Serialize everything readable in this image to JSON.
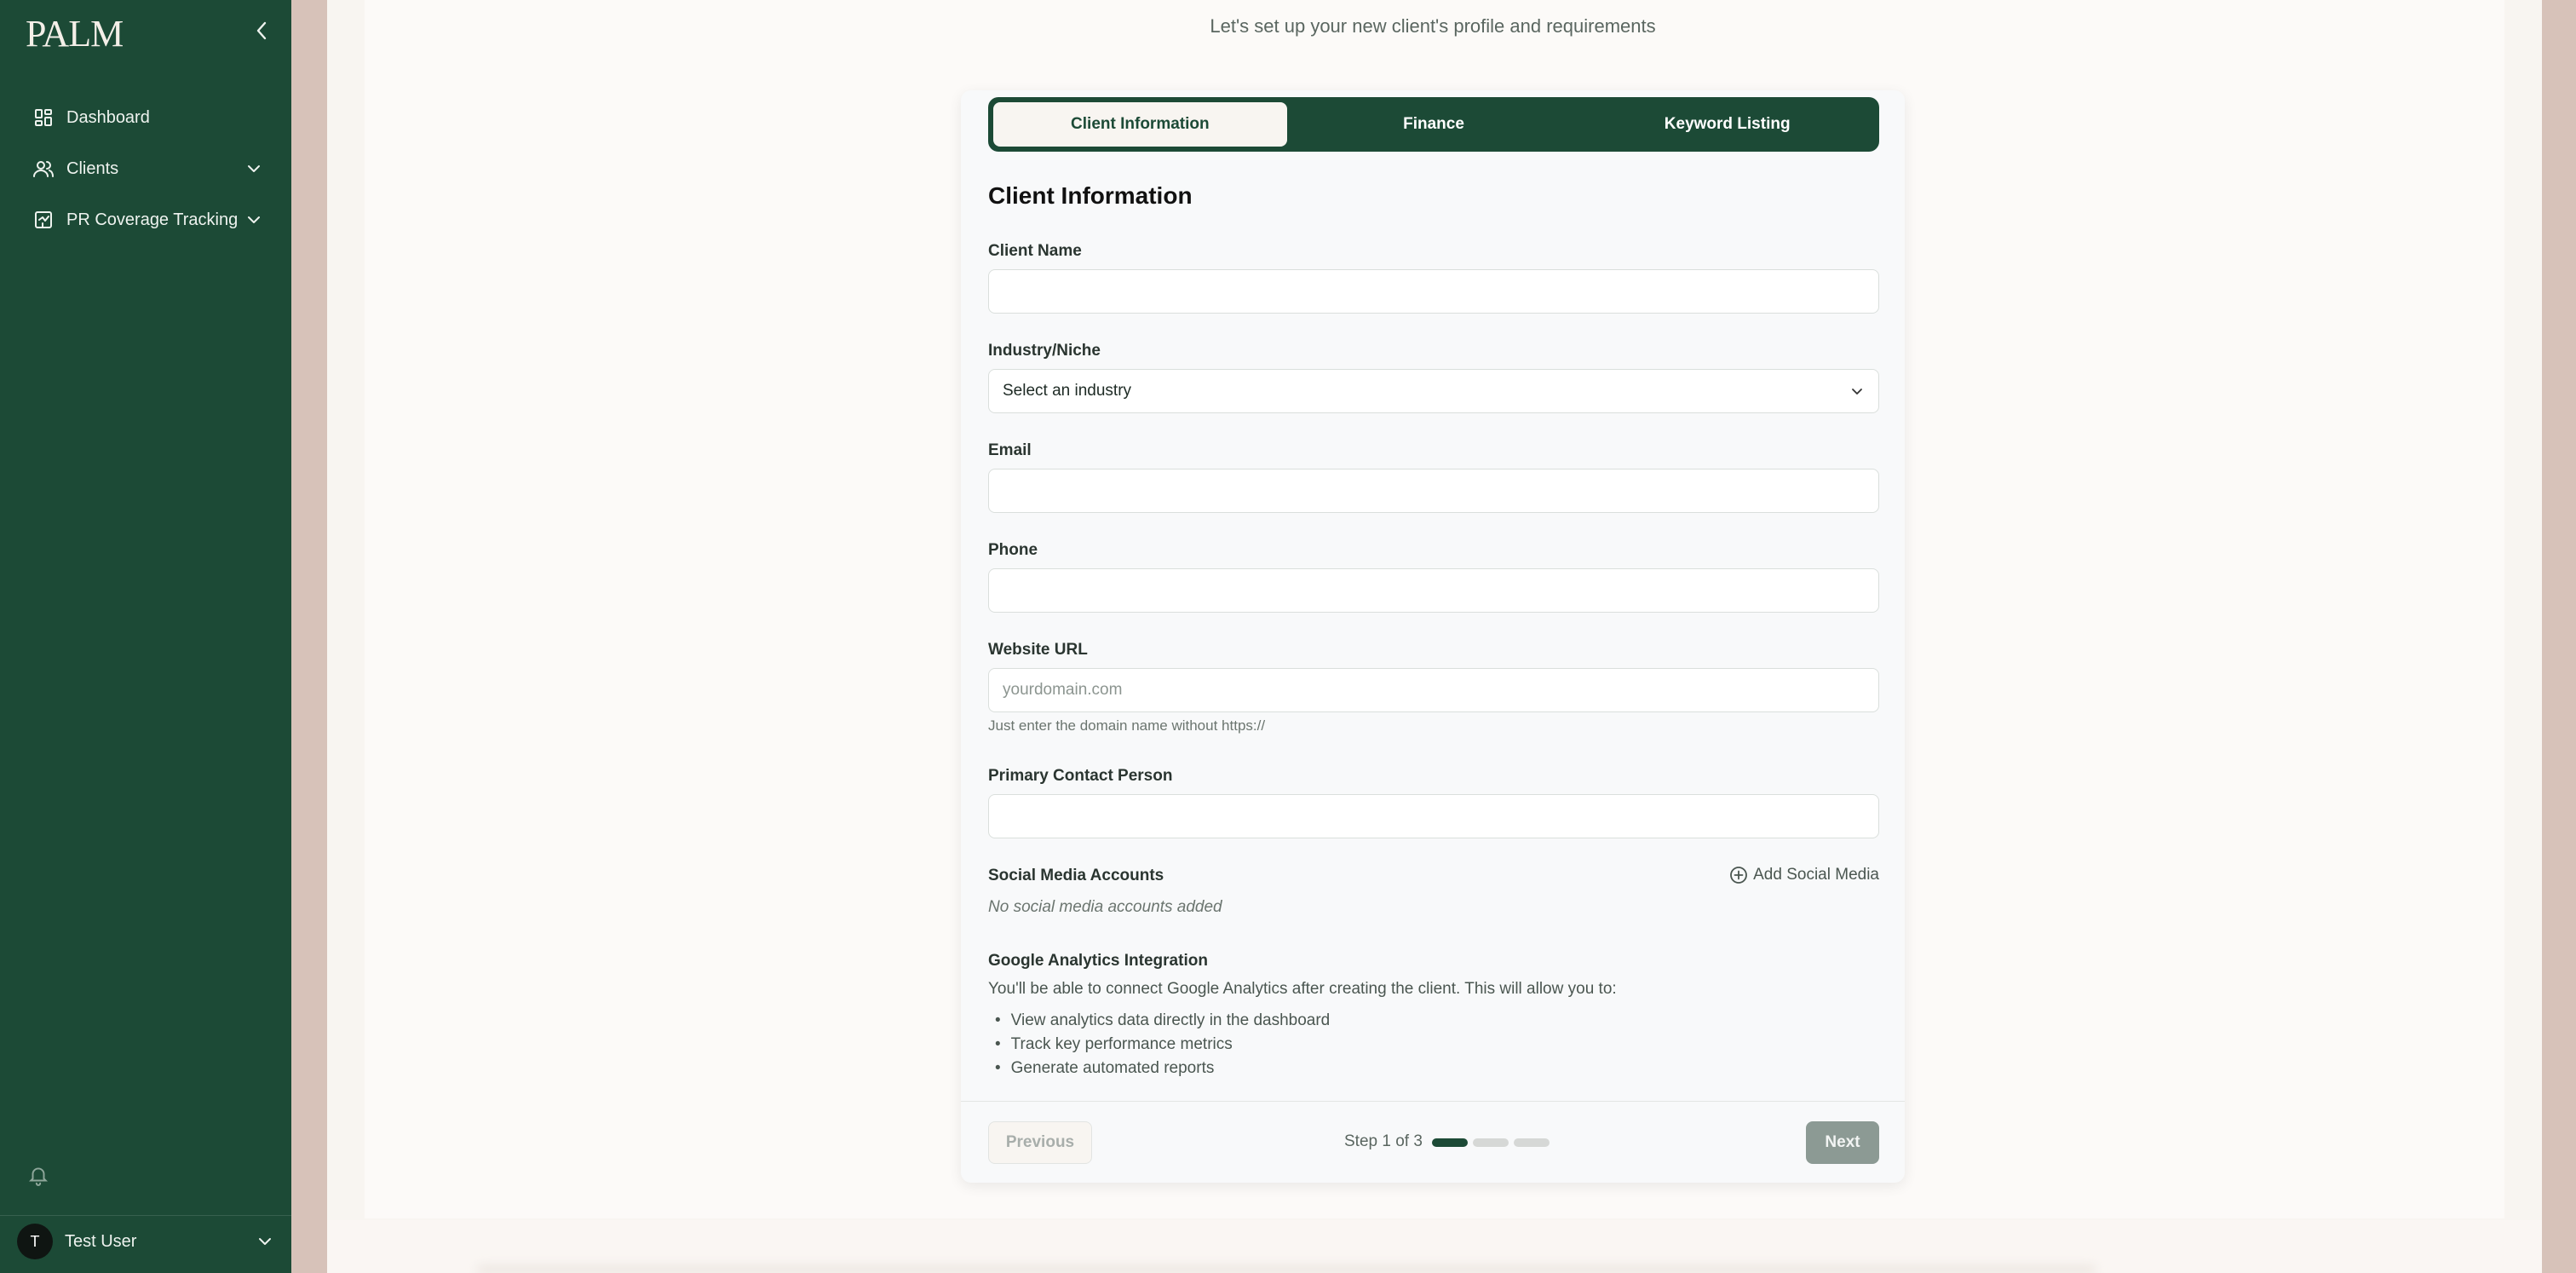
{
  "sidebar": {
    "logo": "PALM",
    "items": [
      {
        "label": "Dashboard",
        "icon": "dashboard-icon"
      },
      {
        "label": "Clients",
        "icon": "users-icon",
        "expandable": true
      },
      {
        "label": "PR Coverage Tracking",
        "icon": "chart-icon",
        "expandable": true
      }
    ],
    "user": {
      "initial": "T",
      "name": "Test User"
    }
  },
  "header": {
    "subtitle": "Let's set up your new client's profile and requirements"
  },
  "tabs": [
    {
      "label": "Client Information",
      "active": true
    },
    {
      "label": "Finance",
      "active": false
    },
    {
      "label": "Keyword Listing",
      "active": false
    }
  ],
  "form": {
    "section_title": "Client Information",
    "client_name": {
      "label": "Client Name",
      "value": ""
    },
    "industry": {
      "label": "Industry/Niche",
      "value": "Select an industry"
    },
    "email": {
      "label": "Email",
      "value": ""
    },
    "phone": {
      "label": "Phone",
      "value": ""
    },
    "website": {
      "label": "Website URL",
      "placeholder": "yourdomain.com",
      "hint": "Just enter the domain name without https://"
    },
    "contact": {
      "label": "Primary Contact Person",
      "value": ""
    },
    "social": {
      "label": "Social Media Accounts",
      "add_label": "Add Social Media",
      "empty": "No social media accounts added"
    },
    "ga": {
      "label": "Google Analytics Integration",
      "description": "You'll be able to connect Google Analytics after creating the client. This will allow you to:",
      "items": [
        "View analytics data directly in the dashboard",
        "Track key performance metrics",
        "Generate automated reports"
      ]
    }
  },
  "footer": {
    "previous_label": "Previous",
    "step_text": "Step 1 of 3",
    "next_label": "Next",
    "current_step": 1,
    "total_steps": 3
  },
  "colors": {
    "brand": "#1c4a36",
    "background": "#d7c2b9",
    "panel": "#f8f5f1"
  }
}
